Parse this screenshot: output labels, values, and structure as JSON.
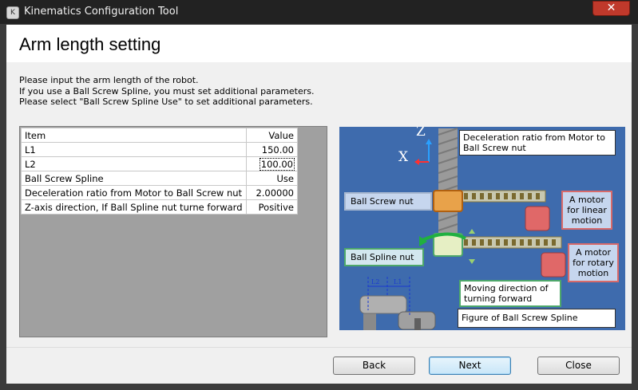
{
  "window": {
    "title": "Kinematics Configuration Tool",
    "close_glyph": "✕"
  },
  "page": {
    "title": "Arm length setting",
    "instructions": [
      "Please input the arm length of the robot.",
      "If you use a Ball Screw Spline, you must set additional parameters.",
      "Please select \"Ball Screw Spline Use\" to set additional parameters."
    ]
  },
  "grid": {
    "headers": {
      "item": "Item",
      "value": "Value"
    },
    "rows": [
      {
        "item": "L1",
        "value": "150.00"
      },
      {
        "item": "L2",
        "value": "100.00"
      },
      {
        "item": "Ball Screw Spline",
        "value": "Use"
      },
      {
        "item": "Deceleration ratio from Motor to Ball Screw nut",
        "value": "2.00000"
      },
      {
        "item": "Z-axis direction, If Ball Spline nut turne forward",
        "value": "Positive"
      }
    ]
  },
  "figure": {
    "axis_z": "Z",
    "axis_x": "X",
    "decel_label": "Deceleration ratio from Motor to Ball Screw nut",
    "ball_screw_nut": "Ball Screw nut",
    "ball_spline_nut": "Ball Spline nut",
    "motor_linear": "A motor for linear motion",
    "motor_rotary": "A motor for rotary motion",
    "moving_direction": "Moving direction of turning forward",
    "caption": "Figure of Ball Screw Spline",
    "dim_l2": "L2",
    "dim_l1": "L1"
  },
  "buttons": {
    "back": "Back",
    "next": "Next",
    "close": "Close"
  },
  "colors": {
    "figure_bg": "#3e6bad",
    "title_bar": "#222222",
    "close_button": "#c0392b"
  }
}
